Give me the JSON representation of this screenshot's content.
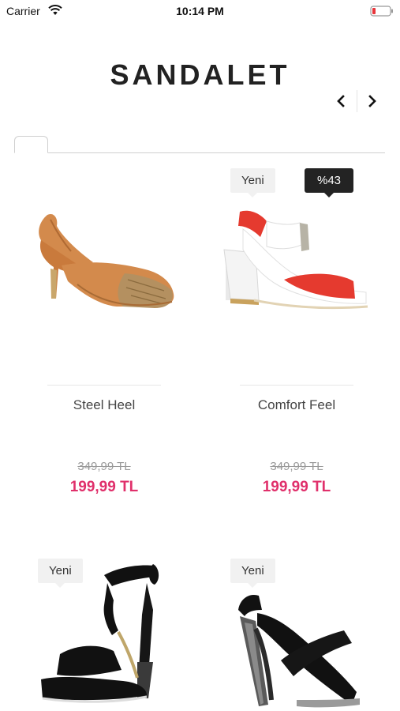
{
  "status_bar": {
    "carrier": "Carrier",
    "time": "10:14 PM",
    "wifi_icon": "wifi-icon",
    "battery_icon": "battery-low-icon",
    "battery_color": "#e8353b"
  },
  "header": {
    "title": "SANDALET",
    "prev_icon": "chevron-left-icon",
    "next_icon": "chevron-right-icon"
  },
  "tabs": [
    {
      "label": ""
    }
  ],
  "colors": {
    "accent_price": "#e0306b",
    "discount_badge_bg": "#232323",
    "new_badge_bg": "#f1f1f1"
  },
  "products": [
    {
      "name": "Steel Heel",
      "old_price": "349,99 TL",
      "new_price": "199,99 TL",
      "badges": [],
      "image": "tan-suede-slingback-heel"
    },
    {
      "name": "Comfort Feel",
      "old_price": "349,99 TL",
      "new_price": "199,99 TL",
      "badges": [
        "Yeni",
        "%43"
      ],
      "image": "red-white-block-heel-sandal"
    },
    {
      "name": "",
      "old_price": "",
      "new_price": "",
      "badges": [
        "Yeni"
      ],
      "image": "black-ankle-strap-heel-sandal"
    },
    {
      "name": "",
      "old_price": "",
      "new_price": "",
      "badges": [
        "Yeni"
      ],
      "image": "black-cross-strap-block-heel"
    }
  ]
}
